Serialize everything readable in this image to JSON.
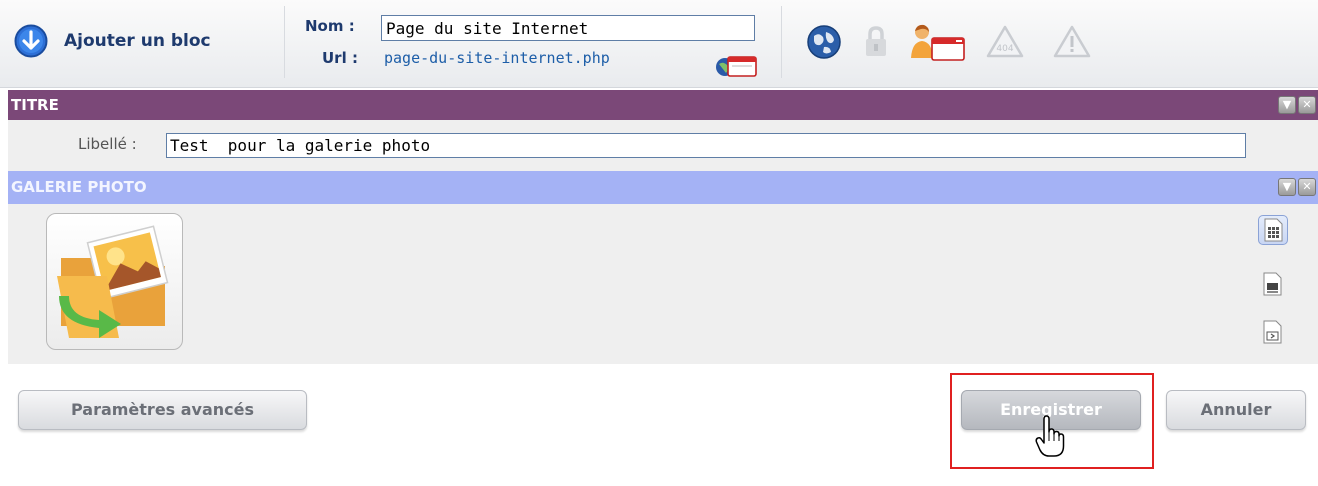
{
  "toolbar": {
    "add_block_label": "Ajouter un bloc",
    "name_label": "Nom :",
    "name_value": "Page du site Internet",
    "url_label": "Url :",
    "url_value": "page-du-site-internet.php",
    "icons": [
      "globe-icon",
      "lock-icon",
      "user-window-icon",
      "error-404-icon",
      "warning-icon"
    ]
  },
  "titre_section": {
    "header": "TITRE",
    "libelle_label": "Libellé :",
    "libelle_value": "Test  pour la galerie photo"
  },
  "galerie_section": {
    "header": "GALERIE PHOTO",
    "layout_icons": [
      "grid-layout-icon",
      "strip-layout-icon",
      "slideshow-layout-icon"
    ]
  },
  "actions": {
    "advanced_label": "Paramètres avancés",
    "save_label": "Enregistrer",
    "cancel_label": "Annuler"
  },
  "colors": {
    "titre_header": "#7b4878",
    "galerie_header": "#a4b2f5",
    "highlight": "#e02020"
  }
}
